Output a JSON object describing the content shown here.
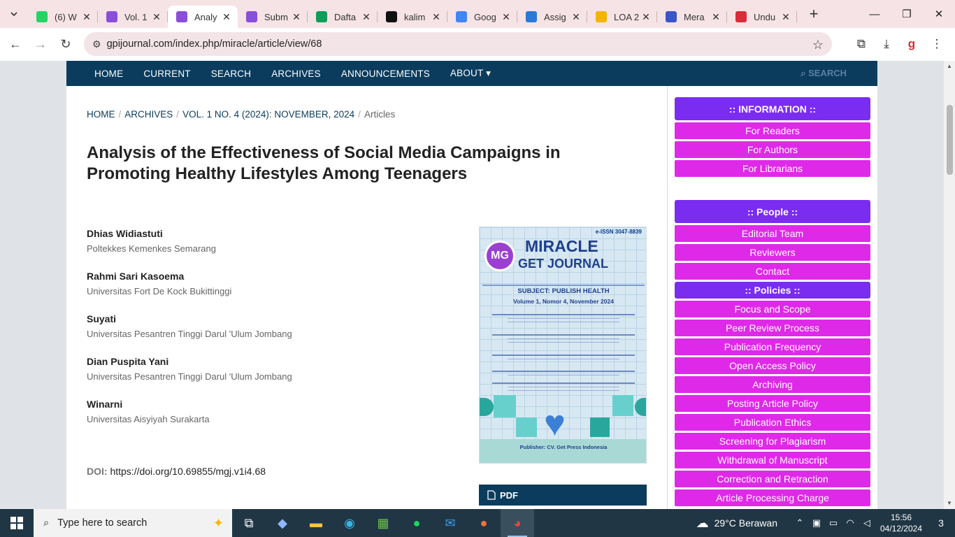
{
  "browser": {
    "tabs": [
      {
        "title": "(6) W",
        "color": "#25d366"
      },
      {
        "title": "Vol. 1",
        "color": "#8a4fd8"
      },
      {
        "title": "Analy",
        "color": "#8a4fd8"
      },
      {
        "title": "Subm",
        "color": "#8a4fd8"
      },
      {
        "title": "Dafta",
        "color": "#0f9d58"
      },
      {
        "title": "kalim",
        "color": "#111111"
      },
      {
        "title": "Goog",
        "color": "#4285f4"
      },
      {
        "title": "Assig",
        "color": "#2b79d6"
      },
      {
        "title": "LOA 2",
        "color": "#f4b400"
      },
      {
        "title": "Mera",
        "color": "#3a55c5"
      },
      {
        "title": "Undu",
        "color": "#d92c3a"
      }
    ],
    "url": "gpijournal.com/index.php/miracle/article/view/68"
  },
  "sitenav": {
    "items": [
      "HOME",
      "CURRENT",
      "SEARCH",
      "ARCHIVES",
      "ANNOUNCEMENTS",
      "ABOUT ▾"
    ],
    "search": "SEARCH"
  },
  "breadcrumb": {
    "home": "HOME",
    "archives": "ARCHIVES",
    "issue": "VOL. 1 NO. 4 (2024): NOVEMBER, 2024",
    "current": "Articles",
    "sep": "/"
  },
  "article": {
    "title": "Analysis of the Effectiveness of Social Media Campaigns in Promoting Healthy Lifestyles Among Teenagers",
    "authors": [
      {
        "name": "Dhias Widiastuti",
        "affiliation": "Poltekkes Kemenkes Semarang"
      },
      {
        "name": "Rahmi Sari Kasoema",
        "affiliation": "Universitas Fort De Kock Bukittinggi"
      },
      {
        "name": "Suyati",
        "affiliation": "Universitas Pesantren Tinggi Darul 'Ulum Jombang"
      },
      {
        "name": "Dian Puspita Yani",
        "affiliation": "Universitas Pesantren Tinggi Darul 'Ulum Jombang"
      },
      {
        "name": "Winarni",
        "affiliation": "Universitas Aisyiyah Surakarta"
      }
    ],
    "doi_label": "DOI:",
    "doi": "https://doi.org/10.69855/mgj.v1i4.68",
    "pdf_label": "PDF"
  },
  "cover": {
    "issn": "e-ISSN 3047-8839",
    "logo": "MG",
    "title1": "MIRACLE",
    "title2": "GET JOURNAL",
    "subject": "SUBJECT: PUBLISH HEALTH",
    "volume": "Volume 1, Nomor 4, November 2024",
    "publisher": "Publisher: CV. Get Press Indonesia"
  },
  "sidebar": {
    "information_header": ":: INFORMATION ::",
    "information": [
      "For Readers",
      "For Authors",
      "For Librarians"
    ],
    "people_header": ":: People ::",
    "people": [
      "Editorial Team",
      "Reviewers",
      "Contact"
    ],
    "policies_header": ":: Policies ::",
    "policies": [
      "Focus and Scope",
      "Peer Review Process",
      "Publication Frequency",
      "Open Access Policy",
      "Archiving",
      "Posting Article Policy",
      "Publication Ethics",
      "Screening for Plagiarism",
      "Withdrawal of Manuscript",
      "Correction and Retraction",
      "Article Processing Charge"
    ]
  },
  "taskbar": {
    "search_placeholder": "Type here to search",
    "temperature": "29°C",
    "weather": "Berawan",
    "time": "15:56",
    "date": "04/12/2024",
    "notifications": "3"
  }
}
